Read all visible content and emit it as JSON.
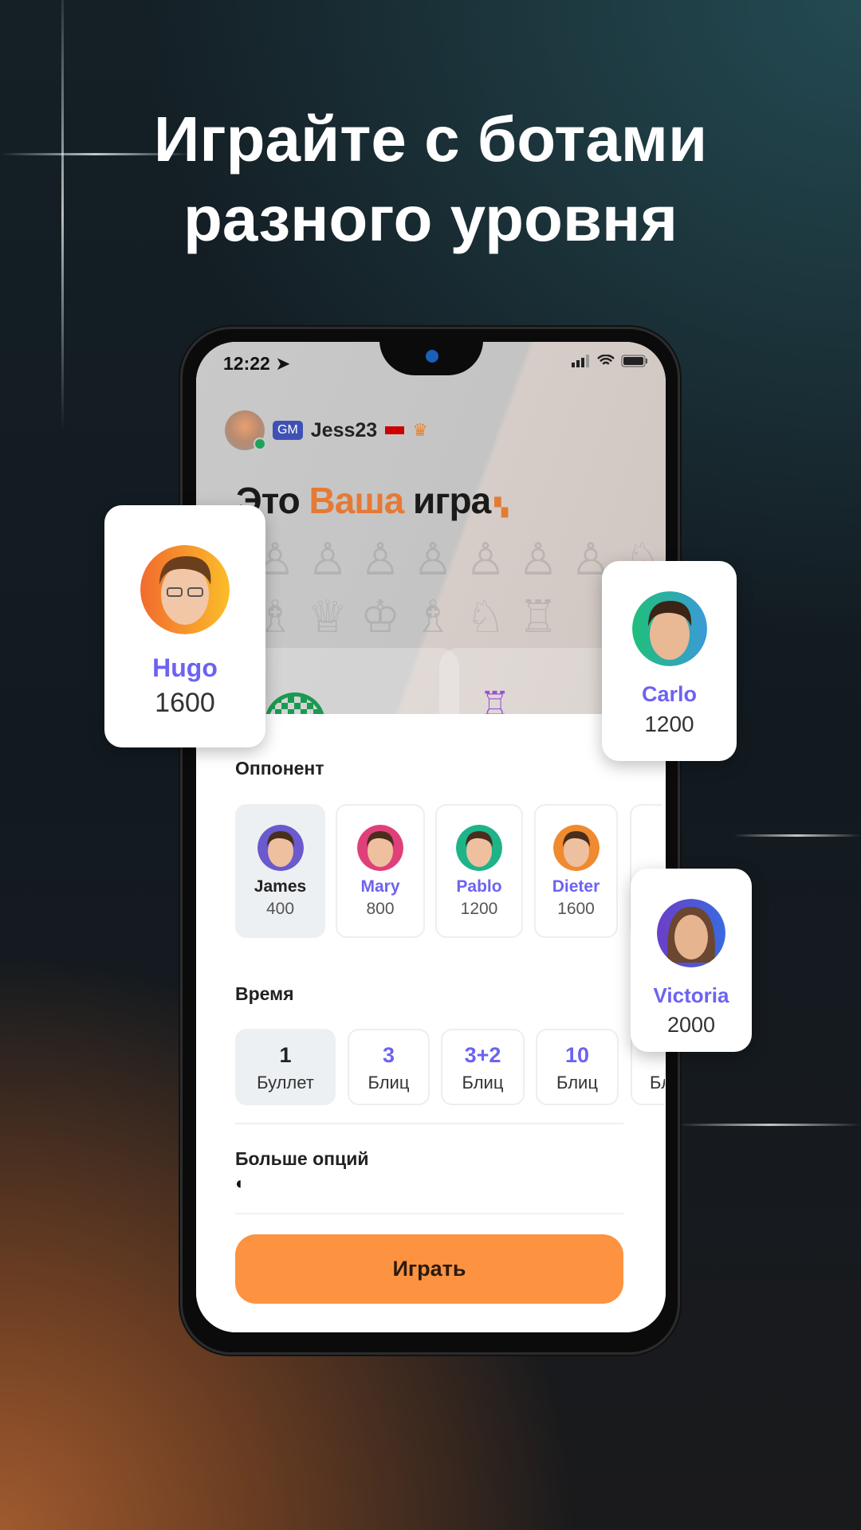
{
  "headline": {
    "line1": "Играйте с ботами",
    "line2": "разного уровня"
  },
  "status": {
    "time": "12:22",
    "icons": [
      "location-arrow-icon",
      "signal-icon",
      "wifi-icon",
      "battery-icon"
    ]
  },
  "user": {
    "badge": "GM",
    "name": "Jess23",
    "icons": [
      "flag-icon",
      "crown-icon"
    ]
  },
  "slogan": {
    "part1": "Это ",
    "accent": "Ваша",
    "part2": " игра"
  },
  "colors": {
    "accent": "#6c63f0",
    "orange": "#fd9240",
    "slogan_accent": "#e57a35"
  },
  "opponent": {
    "label": "Оппонент",
    "items": [
      {
        "name": "James",
        "rating": "400",
        "color": "#6a5acd",
        "selected": true
      },
      {
        "name": "Mary",
        "rating": "800",
        "color": "#e0407a"
      },
      {
        "name": "Pablo",
        "rating": "1200",
        "color": "#1fb38a"
      },
      {
        "name": "Dieter",
        "rating": "1600",
        "color": "#f08a30"
      }
    ]
  },
  "time": {
    "label": "Время",
    "items": [
      {
        "value": "1",
        "name": "Буллет",
        "selected": true
      },
      {
        "value": "3",
        "name": "Блиц"
      },
      {
        "value": "3+2",
        "name": "Блиц"
      },
      {
        "value": "10",
        "name": "Блиц"
      },
      {
        "value": "",
        "name": "Бл"
      }
    ]
  },
  "more_options": {
    "label": "Больше опций",
    "icon": "half-circle-icon",
    "glyph": "◐"
  },
  "play_button": "Играть",
  "floating_bots": [
    {
      "name": "Hugo",
      "rating": "1600"
    },
    {
      "name": "Carlo",
      "rating": "1200"
    },
    {
      "name": "Victoria",
      "rating": "2000"
    }
  ]
}
